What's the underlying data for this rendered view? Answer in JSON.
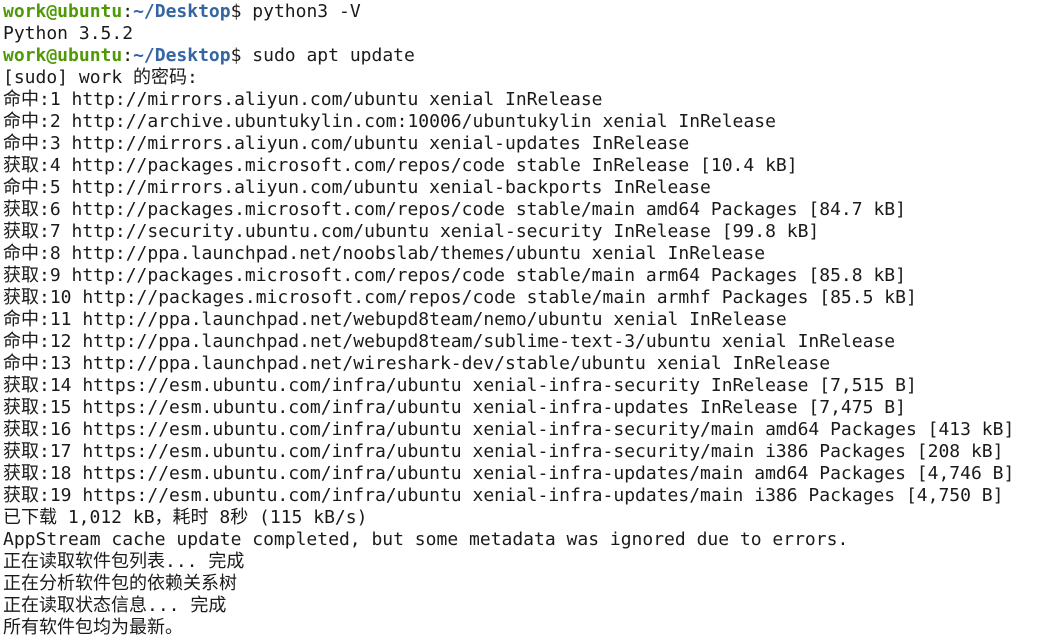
{
  "terminal": {
    "prompt": {
      "user_host": "work@ubuntu",
      "colon": ":",
      "path": "~/Desktop",
      "symbol": "$"
    },
    "lines": [
      {
        "type": "prompt",
        "command": " python3 -V"
      },
      {
        "type": "output",
        "text": "Python 3.5.2"
      },
      {
        "type": "prompt",
        "command": " sudo apt update"
      },
      {
        "type": "output",
        "text": "[sudo] work 的密码:"
      },
      {
        "type": "output",
        "text": "命中:1 http://mirrors.aliyun.com/ubuntu xenial InRelease"
      },
      {
        "type": "output",
        "text": "命中:2 http://archive.ubuntukylin.com:10006/ubuntukylin xenial InRelease"
      },
      {
        "type": "output",
        "text": "命中:3 http://mirrors.aliyun.com/ubuntu xenial-updates InRelease"
      },
      {
        "type": "output",
        "text": "获取:4 http://packages.microsoft.com/repos/code stable InRelease [10.4 kB]"
      },
      {
        "type": "output",
        "text": "命中:5 http://mirrors.aliyun.com/ubuntu xenial-backports InRelease"
      },
      {
        "type": "output",
        "text": "获取:6 http://packages.microsoft.com/repos/code stable/main amd64 Packages [84.7 kB]"
      },
      {
        "type": "output",
        "text": "获取:7 http://security.ubuntu.com/ubuntu xenial-security InRelease [99.8 kB]"
      },
      {
        "type": "output",
        "text": "命中:8 http://ppa.launchpad.net/noobslab/themes/ubuntu xenial InRelease"
      },
      {
        "type": "output",
        "text": "获取:9 http://packages.microsoft.com/repos/code stable/main arm64 Packages [85.8 kB]"
      },
      {
        "type": "output",
        "text": "获取:10 http://packages.microsoft.com/repos/code stable/main armhf Packages [85.5 kB]"
      },
      {
        "type": "output",
        "text": "命中:11 http://ppa.launchpad.net/webupd8team/nemo/ubuntu xenial InRelease"
      },
      {
        "type": "output",
        "text": "命中:12 http://ppa.launchpad.net/webupd8team/sublime-text-3/ubuntu xenial InRelease"
      },
      {
        "type": "output",
        "text": "命中:13 http://ppa.launchpad.net/wireshark-dev/stable/ubuntu xenial InRelease"
      },
      {
        "type": "output",
        "text": "获取:14 https://esm.ubuntu.com/infra/ubuntu xenial-infra-security InRelease [7,515 B]"
      },
      {
        "type": "output",
        "text": "获取:15 https://esm.ubuntu.com/infra/ubuntu xenial-infra-updates InRelease [7,475 B]"
      },
      {
        "type": "output",
        "text": "获取:16 https://esm.ubuntu.com/infra/ubuntu xenial-infra-security/main amd64 Packages [413 kB]"
      },
      {
        "type": "output",
        "text": "获取:17 https://esm.ubuntu.com/infra/ubuntu xenial-infra-security/main i386 Packages [208 kB]"
      },
      {
        "type": "output",
        "text": "获取:18 https://esm.ubuntu.com/infra/ubuntu xenial-infra-updates/main amd64 Packages [4,746 B]"
      },
      {
        "type": "output",
        "text": "获取:19 https://esm.ubuntu.com/infra/ubuntu xenial-infra-updates/main i386 Packages [4,750 B]"
      },
      {
        "type": "output",
        "text": "已下载 1,012 kB，耗时 8秒 (115 kB/s)"
      },
      {
        "type": "output",
        "text": "AppStream cache update completed, but some metadata was ignored due to errors."
      },
      {
        "type": "output",
        "text": "正在读取软件包列表... 完成"
      },
      {
        "type": "output",
        "text": "正在分析软件包的依赖关系树"
      },
      {
        "type": "output",
        "text": "正在读取状态信息... 完成"
      },
      {
        "type": "output",
        "text": "所有软件包均为最新。"
      }
    ],
    "colors": {
      "background": "#ffffff",
      "text": "#1a1a1a",
      "prompt_user": "#4e9a06",
      "prompt_path": "#3465a4"
    }
  }
}
